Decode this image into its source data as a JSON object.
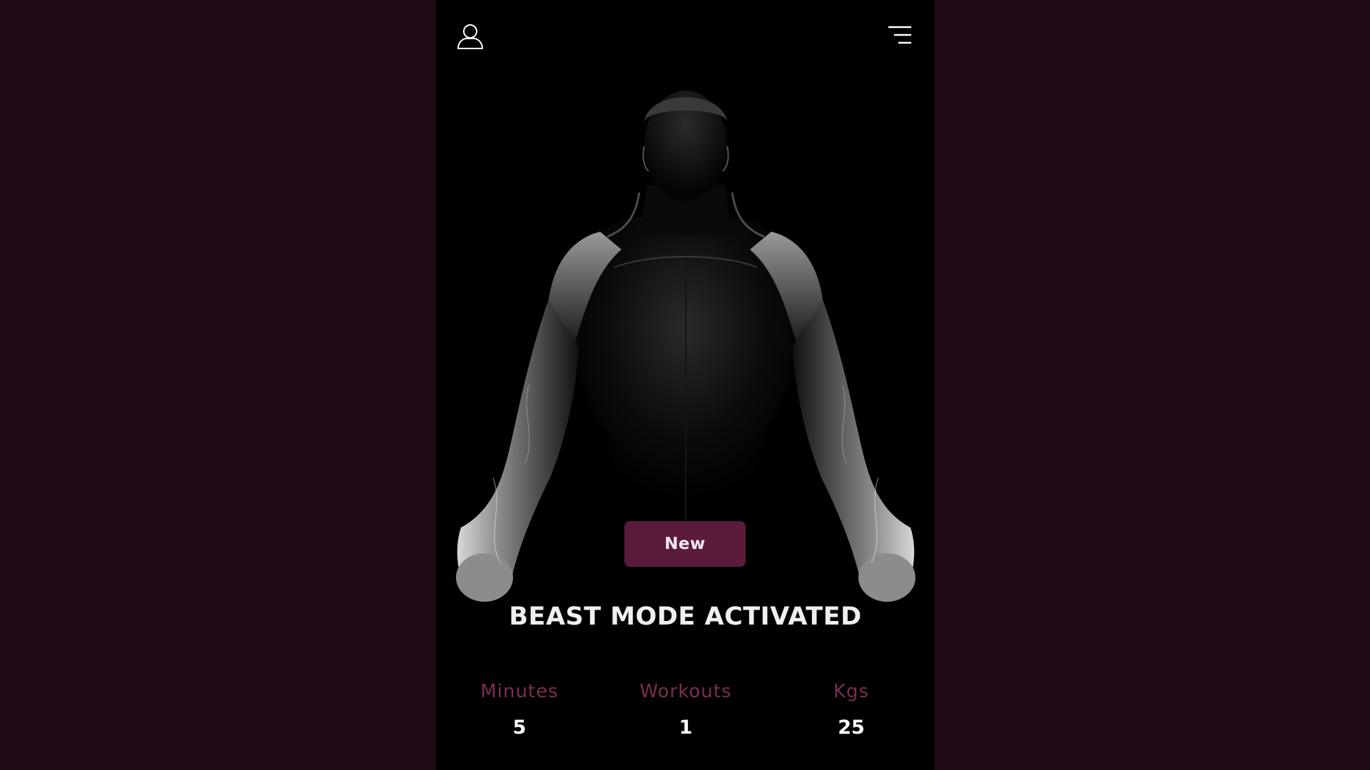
{
  "header": {
    "profile_icon": "user-outline-icon",
    "menu_icon": "hamburger-menu-icon"
  },
  "hero": {
    "image": "muscular-man-silhouette",
    "badge_button_label": "New",
    "headline": "BEAST MODE ACTIVATED"
  },
  "stats": [
    {
      "label": "Minutes",
      "value": "5"
    },
    {
      "label": "Workouts",
      "value": "1"
    },
    {
      "label": "Kgs",
      "value": "25"
    }
  ],
  "colors": {
    "page_background": "#1d0a14",
    "screen_background": "#000000",
    "accent": "#5a1c3a",
    "stat_label": "#7c2d51",
    "text": "#ffffff"
  }
}
